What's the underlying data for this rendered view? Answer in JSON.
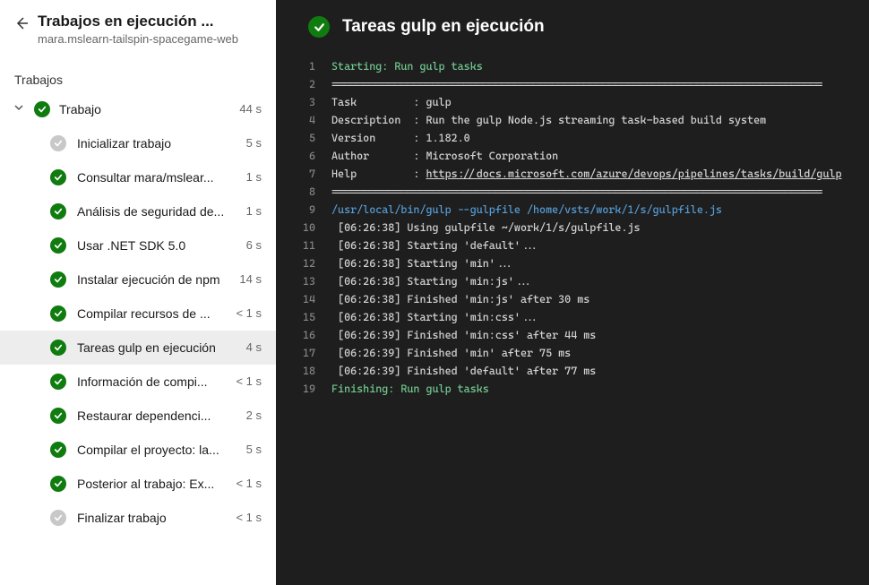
{
  "header": {
    "title": "Trabajos en ejecución ...",
    "subtitle": "mara.mslearn-tailspin-spacegame-web"
  },
  "sectionLabel": "Trabajos",
  "job": {
    "name": "Trabajo",
    "duration": "44 s",
    "status": "success"
  },
  "steps": [
    {
      "name": "Inicializar trabajo",
      "duration": "5 s",
      "status": "neutral",
      "selected": false
    },
    {
      "name": "Consultar mara/mslear...",
      "duration": "1 s",
      "status": "success",
      "selected": false
    },
    {
      "name": "Análisis de seguridad de...",
      "duration": "1 s",
      "status": "success",
      "selected": false
    },
    {
      "name": "Usar .NET SDK 5.0",
      "duration": "6 s",
      "status": "success",
      "selected": false
    },
    {
      "name": "Instalar ejecución de npm",
      "duration": "14 s",
      "status": "success",
      "selected": false
    },
    {
      "name": "Compilar recursos de ...",
      "duration": "< 1 s",
      "status": "success",
      "selected": false
    },
    {
      "name": "Tareas gulp en ejecución",
      "duration": "4 s",
      "status": "success",
      "selected": true
    },
    {
      "name": "Información de compi...",
      "duration": "< 1 s",
      "status": "success",
      "selected": false
    },
    {
      "name": "Restaurar dependenci...",
      "duration": "2 s",
      "status": "success",
      "selected": false
    },
    {
      "name": "Compilar el proyecto: la...",
      "duration": "5 s",
      "status": "success",
      "selected": false
    },
    {
      "name": "Posterior al trabajo: Ex...",
      "duration": "< 1 s",
      "status": "success",
      "selected": false
    },
    {
      "name": "Finalizar trabajo",
      "duration": "< 1 s",
      "status": "neutral",
      "selected": false
    }
  ],
  "mainTitle": "Tareas gulp en ejecución",
  "log": [
    {
      "n": 1,
      "segs": [
        {
          "t": "Starting: Run gulp tasks",
          "c": "green"
        }
      ]
    },
    {
      "n": 2,
      "segs": [
        {
          "t": "==============================================================================",
          "c": ""
        }
      ]
    },
    {
      "n": 3,
      "segs": [
        {
          "t": "Task         : gulp",
          "c": ""
        }
      ]
    },
    {
      "n": 4,
      "segs": [
        {
          "t": "Description  : Run the gulp Node.js streaming task-based build system",
          "c": ""
        }
      ]
    },
    {
      "n": 5,
      "segs": [
        {
          "t": "Version      : 1.182.0",
          "c": ""
        }
      ]
    },
    {
      "n": 6,
      "segs": [
        {
          "t": "Author       : Microsoft Corporation",
          "c": ""
        }
      ]
    },
    {
      "n": 7,
      "segs": [
        {
          "t": "Help         : ",
          "c": ""
        },
        {
          "t": "https://docs.microsoft.com/azure/devops/pipelines/tasks/build/gulp",
          "c": "link"
        }
      ]
    },
    {
      "n": 8,
      "segs": [
        {
          "t": "==============================================================================",
          "c": ""
        }
      ]
    },
    {
      "n": 9,
      "segs": [
        {
          "t": "/usr/local/bin/gulp --gulpfile /home/vsts/work/1/s/gulpfile.js",
          "c": "blue"
        }
      ]
    },
    {
      "n": 10,
      "segs": [
        {
          "t": " [06:26:38] Using gulpfile ~/work/1/s/gulpfile.js",
          "c": ""
        }
      ]
    },
    {
      "n": 11,
      "segs": [
        {
          "t": " [06:26:38] Starting 'default'...",
          "c": ""
        }
      ]
    },
    {
      "n": 12,
      "segs": [
        {
          "t": " [06:26:38] Starting 'min'...",
          "c": ""
        }
      ]
    },
    {
      "n": 13,
      "segs": [
        {
          "t": " [06:26:38] Starting 'min:js'...",
          "c": ""
        }
      ]
    },
    {
      "n": 14,
      "segs": [
        {
          "t": " [06:26:38] Finished 'min:js' after 30 ms",
          "c": ""
        }
      ]
    },
    {
      "n": 15,
      "segs": [
        {
          "t": " [06:26:38] Starting 'min:css'...",
          "c": ""
        }
      ]
    },
    {
      "n": 16,
      "segs": [
        {
          "t": " [06:26:39] Finished 'min:css' after 44 ms",
          "c": ""
        }
      ]
    },
    {
      "n": 17,
      "segs": [
        {
          "t": " [06:26:39] Finished 'min' after 75 ms",
          "c": ""
        }
      ]
    },
    {
      "n": 18,
      "segs": [
        {
          "t": " [06:26:39] Finished 'default' after 77 ms",
          "c": ""
        }
      ]
    },
    {
      "n": 19,
      "segs": [
        {
          "t": "Finishing: Run gulp tasks",
          "c": "green"
        }
      ]
    }
  ]
}
